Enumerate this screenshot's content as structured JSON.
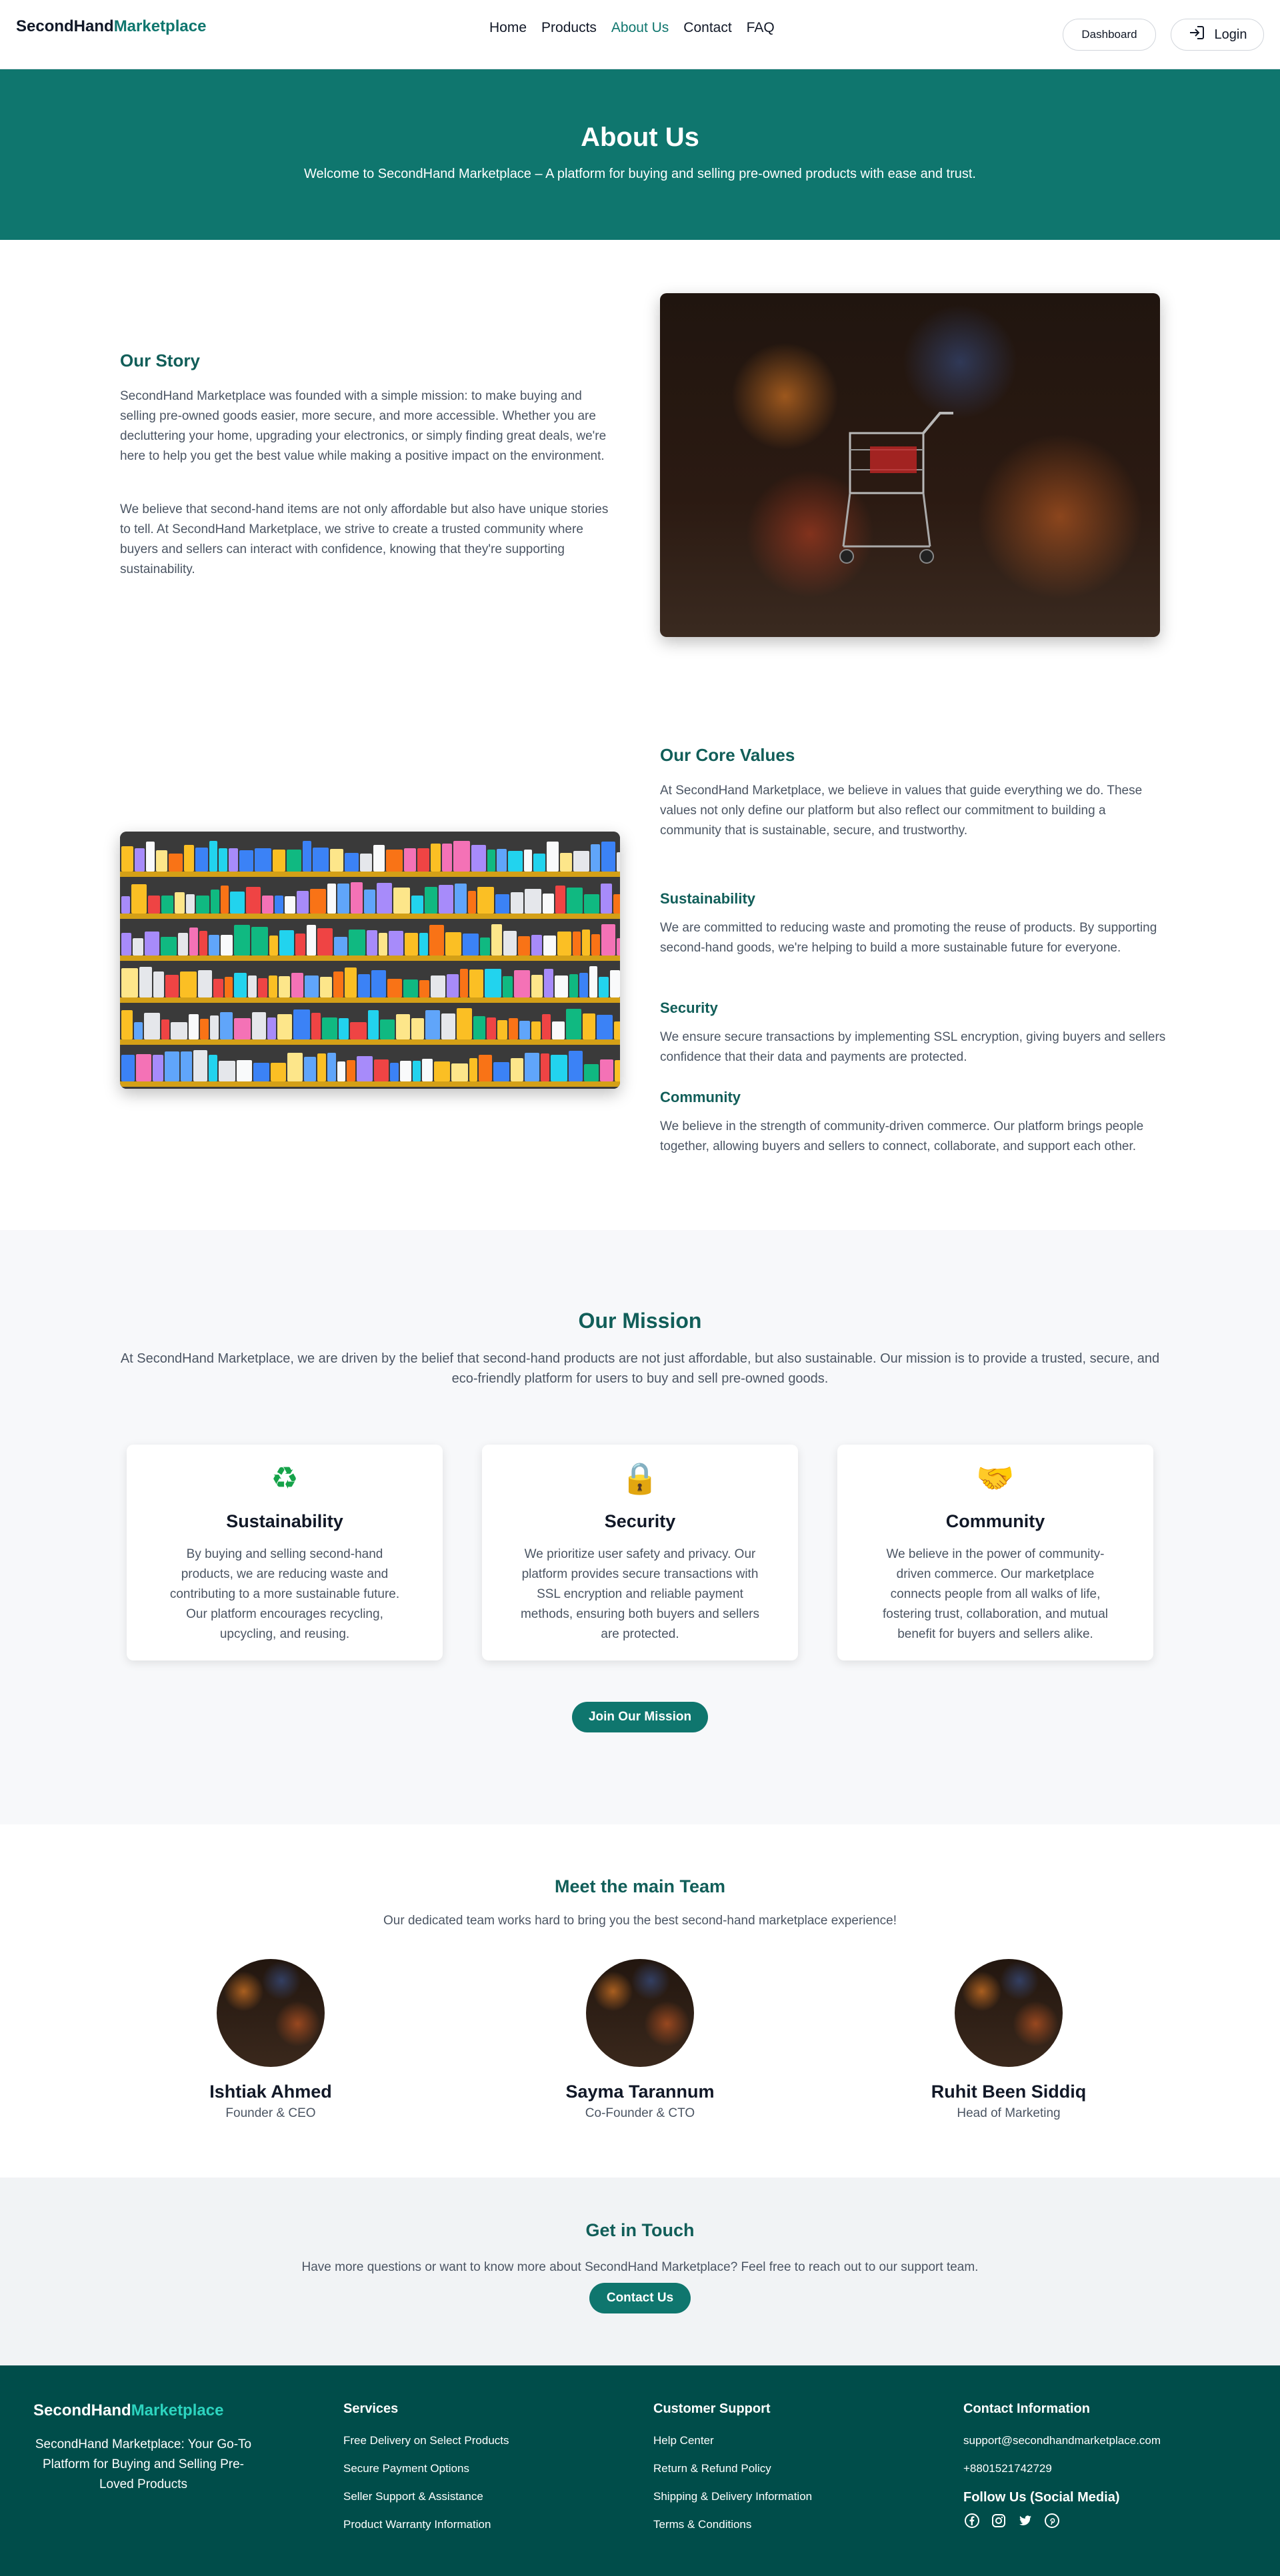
{
  "nav": {
    "logo_part1": "SecondHand",
    "logo_part2": "Marketplace",
    "links": [
      "Home",
      "Products",
      "About Us",
      "Contact",
      "FAQ"
    ],
    "active_link": "About Us",
    "dashboard_label": "Dashboard",
    "login_label": "Login"
  },
  "hero": {
    "title": "About Us",
    "subtitle": "Welcome to SecondHand Marketplace – A platform for buying and selling pre-owned products with ease and trust."
  },
  "story": {
    "title": "Our Story",
    "p1": "SecondHand Marketplace was founded with a simple mission: to make buying and selling pre-owned goods easier, more secure, and more accessible. Whether you are decluttering your home, upgrading your electronics, or simply finding great deals, we're here to help you get the best value while making a positive impact on the environment.",
    "p2": "We believe that second-hand items are not only affordable but also have unique stories to tell. At SecondHand Marketplace, we strive to create a trusted community where buyers and sellers can interact with confidence, knowing that they're supporting sustainability."
  },
  "core_values": {
    "title": "Our Core Values",
    "intro": "At SecondHand Marketplace, we believe in values that guide everything we do. These values not only define our platform but also reflect our commitment to building a community that is sustainable, secure, and trustworthy.",
    "items": [
      {
        "title": "Sustainability",
        "text": "We are committed to reducing waste and promoting the reuse of products. By supporting second-hand goods, we're helping to build a more sustainable future for everyone."
      },
      {
        "title": "Security",
        "text": "We ensure secure transactions by implementing SSL encryption, giving buyers and sellers confidence that their data and payments are protected."
      },
      {
        "title": "Community",
        "text": "We believe in the strength of community-driven commerce. Our platform brings people together, allowing buyers and sellers to connect, collaborate, and support each other."
      }
    ]
  },
  "mission": {
    "title": "Our Mission",
    "text": "At SecondHand Marketplace, we are driven by the belief that second-hand products are not just affordable, but also sustainable. Our mission is to provide a trusted, secure, and eco-friendly platform for users to buy and sell pre-owned goods.",
    "cards": [
      {
        "icon": "recycle-icon",
        "glyph": "♻",
        "title": "Sustainability",
        "text": "By buying and selling second-hand products, we are reducing waste and contributing to a more sustainable future. Our platform encourages recycling, upcycling, and reusing."
      },
      {
        "icon": "lock-icon",
        "glyph": "🔒",
        "title": "Security",
        "text": "We prioritize user safety and privacy. Our platform provides secure transactions with SSL encryption and reliable payment methods, ensuring both buyers and sellers are protected."
      },
      {
        "icon": "handshake-icon",
        "glyph": "🤝",
        "title": "Community",
        "text": "We believe in the power of community-driven commerce. Our marketplace connects people from all walks of life, fostering trust, collaboration, and mutual benefit for buyers and sellers alike."
      }
    ],
    "button_label": "Join Our Mission"
  },
  "team": {
    "title": "Meet the main Team",
    "subtitle": "Our dedicated team works hard to bring you the best second-hand marketplace experience!",
    "members": [
      {
        "name": "Ishtiak Ahmed",
        "role": "Founder & CEO"
      },
      {
        "name": "Sayma Tarannum",
        "role": "Co-Founder & CTO"
      },
      {
        "name": "Ruhit Been Siddiq",
        "role": "Head of Marketing"
      }
    ]
  },
  "contact": {
    "title": "Get in Touch",
    "text": "Have more questions or want to know more about SecondHand Marketplace? Feel free to reach out to our support team.",
    "button_label": "Contact Us"
  },
  "footer": {
    "logo_part1": "SecondHand",
    "logo_part2": "Marketplace",
    "tagline": "SecondHand Marketplace: Your Go-To Platform for Buying and Selling Pre-Loved Products",
    "services_title": "Services",
    "services": [
      "Free Delivery on Select Products",
      "Secure Payment Options",
      "Seller Support & Assistance",
      "Product Warranty Information"
    ],
    "support_title": "Customer Support",
    "support": [
      "Help Center",
      "Return & Refund Policy",
      "Shipping & Delivery Information",
      "Terms & Conditions"
    ],
    "contact_title": "Contact Information",
    "email": "support@secondhandmarketplace.com",
    "phone": "+8801521742729",
    "social_title": "Follow Us (Social Media)",
    "social_icons": [
      "facebook-icon",
      "instagram-icon",
      "twitter-icon",
      "pinterest-icon"
    ]
  },
  "colors": {
    "brand": "#0f766e",
    "heading": "#115e59",
    "footer_bg": "#004d4a"
  }
}
